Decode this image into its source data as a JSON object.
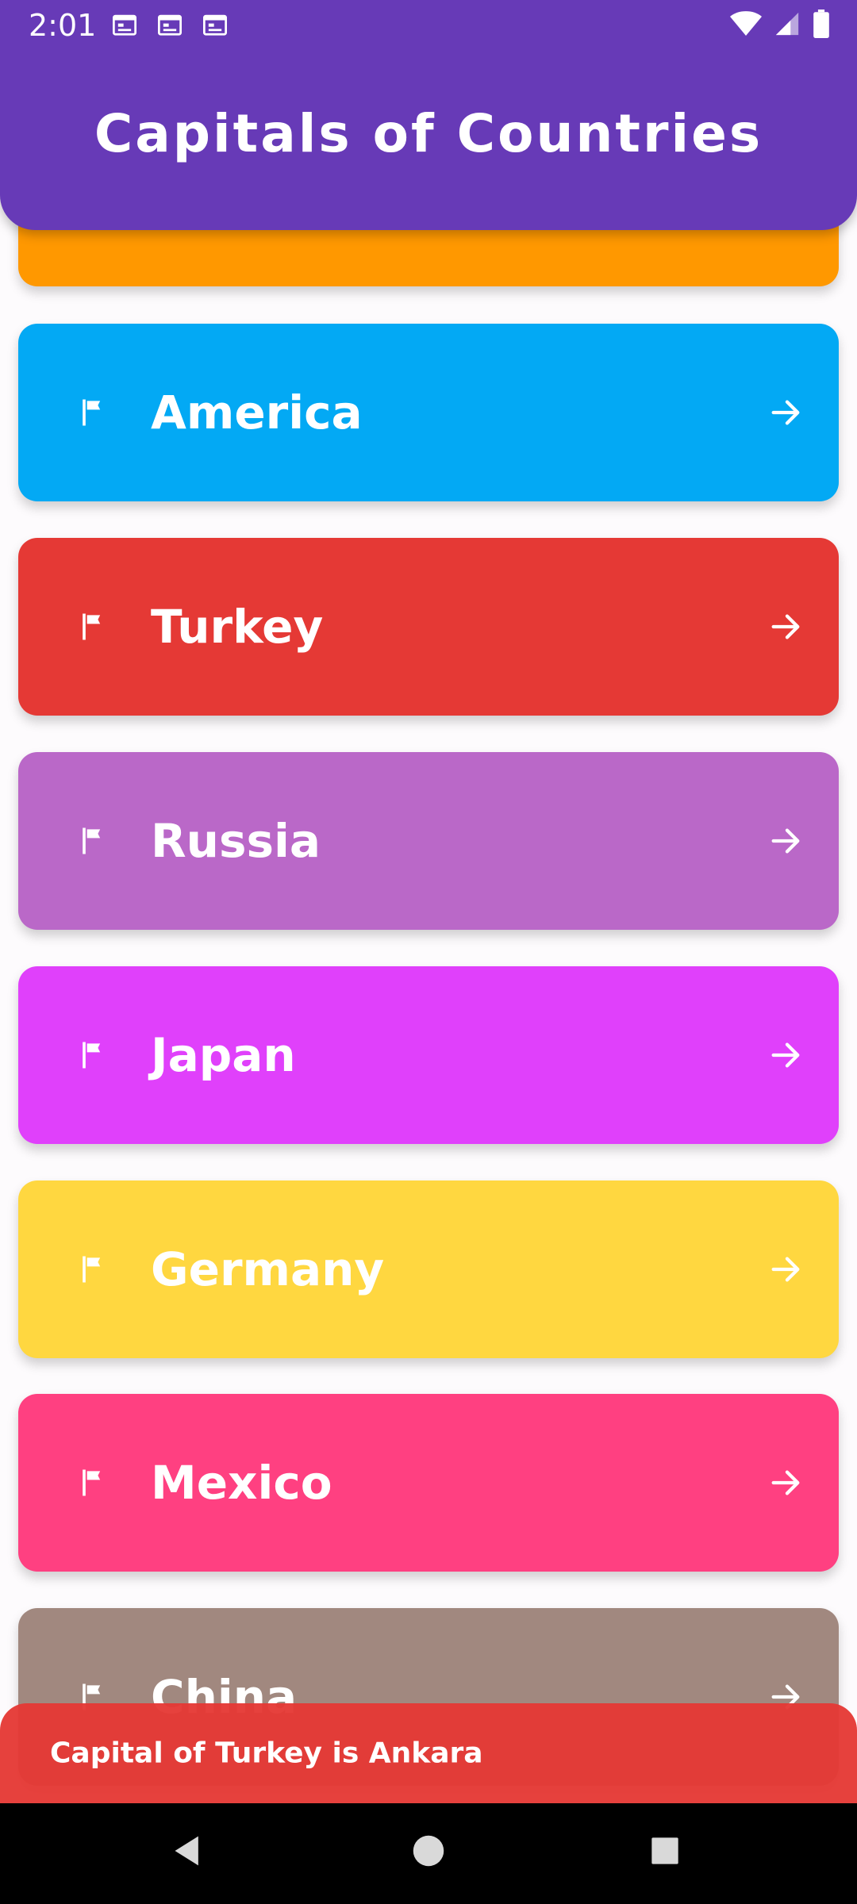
{
  "status_bar": {
    "time": "2:01",
    "notification_icons": [
      "calendar-icon",
      "calendar-icon",
      "calendar-icon"
    ],
    "right_icons": [
      "wifi-icon",
      "signal-icon",
      "battery-icon"
    ]
  },
  "app_bar": {
    "title": "Capitals of Countries",
    "color": "#673ab7"
  },
  "countries": [
    {
      "name": "",
      "color": "#ff9800",
      "icon": "flag-icon",
      "trailing_icon": "arrow-right-icon"
    },
    {
      "name": "America",
      "color": "#03a9f4",
      "icon": "flag-icon",
      "trailing_icon": "arrow-right-icon"
    },
    {
      "name": "Turkey",
      "color": "#e53935",
      "icon": "flag-icon",
      "trailing_icon": "arrow-right-icon"
    },
    {
      "name": "Russia",
      "color": "#ba68c8",
      "icon": "flag-icon",
      "trailing_icon": "arrow-right-icon"
    },
    {
      "name": "Japan",
      "color": "#e040fb",
      "icon": "flag-icon",
      "trailing_icon": "arrow-right-icon"
    },
    {
      "name": "Germany",
      "color": "#ffd740",
      "icon": "flag-icon",
      "trailing_icon": "arrow-right-icon"
    },
    {
      "name": "Mexico",
      "color": "#ff4081",
      "icon": "flag-icon",
      "trailing_icon": "arrow-right-icon"
    },
    {
      "name": "China",
      "color": "#a1887f",
      "icon": "flag-icon",
      "trailing_icon": "arrow-right-icon"
    }
  ],
  "snackbar": {
    "text": "Capital of Turkey is Ankara",
    "color": "#e53935"
  },
  "nav_bar": {
    "buttons": [
      "back-icon",
      "home-icon",
      "recents-icon"
    ]
  }
}
